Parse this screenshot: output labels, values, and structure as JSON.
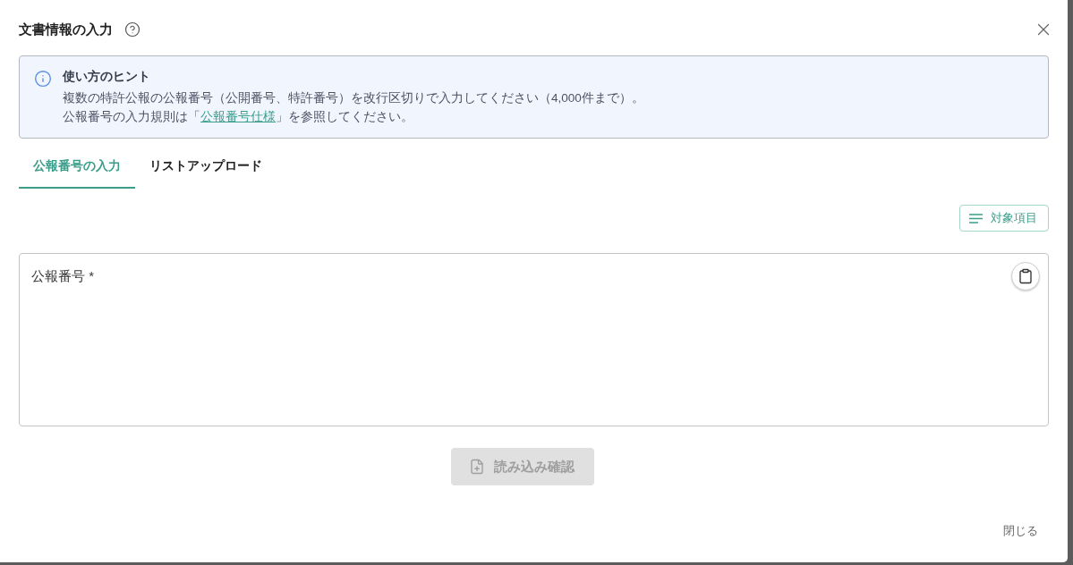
{
  "dialog": {
    "title": "文書情報の入力"
  },
  "hint": {
    "title": "使い方のヒント",
    "line_1": "複数の特許公報の公報番号（公開番号、特許番号）を改行区切りで入力してください（4,000件まで）。",
    "line_2": {
      "before": "公報番号の入力規則は「",
      "link": "公報番号仕様",
      "after": "」を参照してください。"
    }
  },
  "tabs": [
    {
      "label": "公報番号の入力",
      "selected": true
    },
    {
      "label": "リストアップロード",
      "selected": false
    }
  ],
  "columns_button": {
    "label": "対象項目"
  },
  "number_field": {
    "label": "公報番号 *"
  },
  "load_button": {
    "label": "読み込み確認",
    "disabled": true
  },
  "footer": {
    "close_label": "閉じる"
  }
}
